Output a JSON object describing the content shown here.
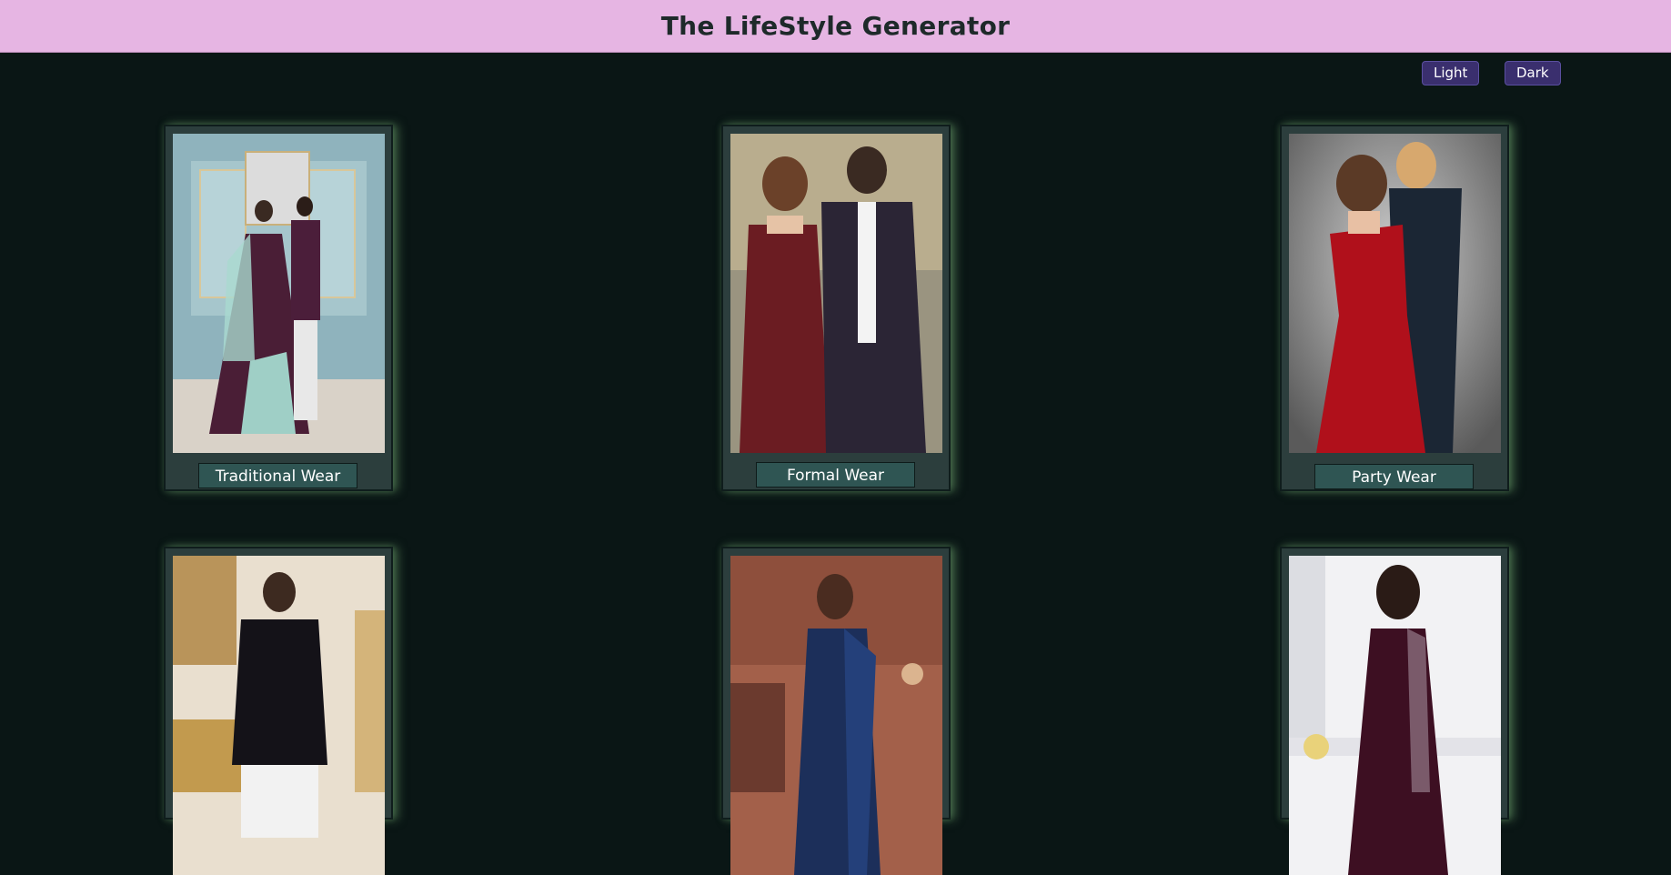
{
  "header": {
    "title": "The LifeStyle Generator"
  },
  "theme": {
    "light_label": "Light",
    "dark_label": "Dark"
  },
  "cards": [
    {
      "label": "Traditional Wear",
      "image": "couple-traditional-wear-photo"
    },
    {
      "label": "Formal Wear",
      "image": "couple-formal-wear-photo"
    },
    {
      "label": "Party Wear",
      "image": "couple-party-wear-photo"
    },
    {
      "label": "",
      "image": "man-sherwani-photo"
    },
    {
      "label": "",
      "image": "woman-saree-photo"
    },
    {
      "label": "",
      "image": "girl-gown-photo"
    }
  ],
  "colors": {
    "page_background": "#0a1615",
    "header_background": "#e6b5e3",
    "card_background": "#2c3e3d",
    "card_glow": "#6ea06e",
    "label_background": "#2f5553",
    "theme_button": "#3a2f6e"
  }
}
